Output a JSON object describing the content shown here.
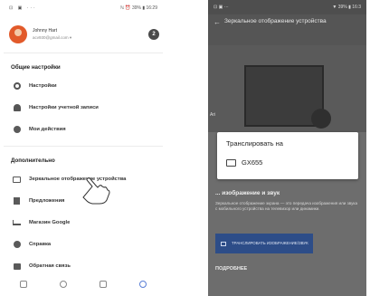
{
  "left": {
    "status_left": "⊡ ▣ ···",
    "status_right": "ℕ ⏰ 39% ▮ 16:29",
    "account_name": "Johnny Hart",
    "account_email": "acv930@gmail.com ▾",
    "account_badge": "2",
    "section_general": "Общие настройки",
    "item_settings": "Настройки",
    "item_account_settings": "Настройки учетной записи",
    "item_my_actions": "Мои действия",
    "section_extra": "Дополнительно",
    "item_mirror": "Зеркальное отображение устройства",
    "item_offers": "Предложения",
    "item_store": "Магазин Google",
    "item_help": "Справка",
    "item_feedback": "Обратная связь"
  },
  "right": {
    "status_left": "⊡ ▣ ···",
    "status_right": "▼ 39% ▮ 16:3",
    "title": "Зеркальное отображение устройства",
    "ear_label": "Ari",
    "dialog_title": "Транслировать на",
    "dialog_device": "GX655",
    "subtitle": "... изображение и звук",
    "description": "Зеркальное отображение экрана — это передача изображения или звука с мобильного устройства на телевизор или динамики.",
    "button_label": "ТРАНСЛИРОВАТЬ ИЗОБРАЖЕНИЕ/ЗВУК",
    "more": "ПОДРОБНЕЕ"
  }
}
